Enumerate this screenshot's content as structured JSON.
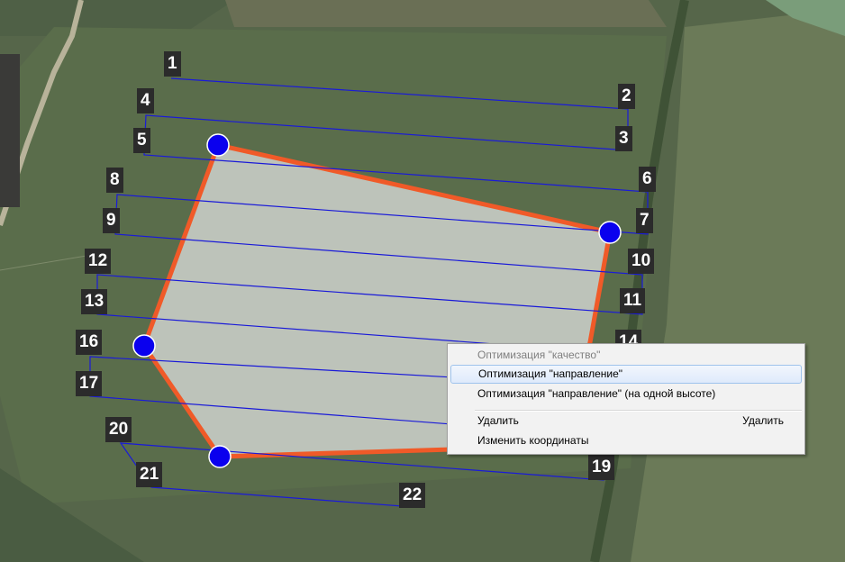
{
  "map": {
    "waypoints": [
      {
        "num": "1"
      },
      {
        "num": "2"
      },
      {
        "num": "3"
      },
      {
        "num": "4"
      },
      {
        "num": "5"
      },
      {
        "num": "6"
      },
      {
        "num": "7"
      },
      {
        "num": "8"
      },
      {
        "num": "9"
      },
      {
        "num": "10"
      },
      {
        "num": "11"
      },
      {
        "num": "12"
      },
      {
        "num": "13"
      },
      {
        "num": "14"
      },
      {
        "num": "16"
      },
      {
        "num": "17"
      },
      {
        "num": "19"
      },
      {
        "num": "20"
      },
      {
        "num": "21"
      },
      {
        "num": "22"
      }
    ],
    "colors": {
      "polygon_fill": "#c8ccc6",
      "polygon_edge": "#f05a28",
      "vertex": "#0a00ee",
      "path": "#1a1ad8",
      "label_bg": "#2b2b2b"
    },
    "icons": [
      "vertex-handle-icon"
    ]
  },
  "context_menu": {
    "items": {
      "opt_quality": "Оптимизация \"качество\"",
      "opt_direction": "Оптимизация \"направление\"",
      "opt_direction_same_alt": "Оптимизация \"направление\" (на одной высоте)",
      "delete": "Удалить",
      "delete_shortcut": "Удалить",
      "edit_coords": "Изменить координаты"
    }
  }
}
